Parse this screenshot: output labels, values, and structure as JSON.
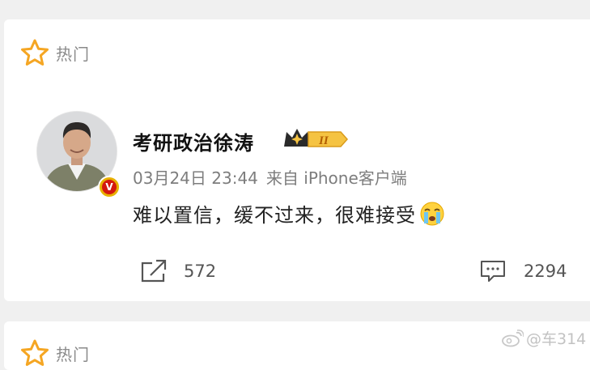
{
  "section": {
    "title": "热门"
  },
  "post": {
    "author": "考研政治徐涛",
    "level_badge": "II",
    "date": "03月24日 23:44",
    "source": "来自 iPhone客户端",
    "text": "难以置信，缓不过来，很难接受",
    "verified_badge": "V",
    "reposts": "572",
    "comments": "2294"
  },
  "watermark": {
    "text": "@车314"
  },
  "colors": {
    "accent_orange": "#f5a623",
    "verified_red": "#d4190f",
    "text_gray": "#8a8a8a"
  }
}
